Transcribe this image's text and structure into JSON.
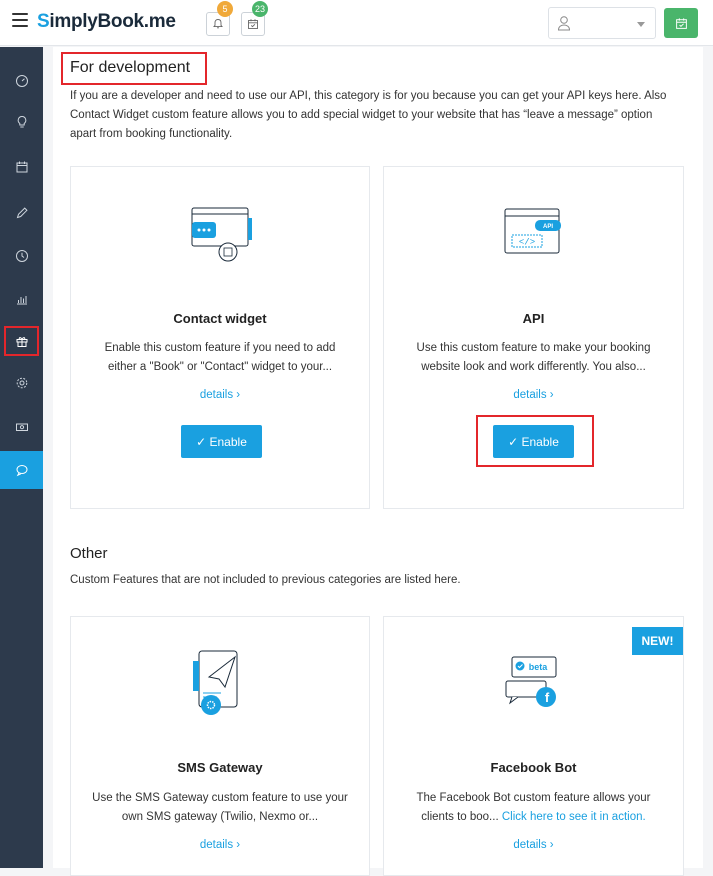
{
  "app": {
    "logo_s": "S",
    "logo_rest": "implyBook.me"
  },
  "header": {
    "notifications_count": "5",
    "calendar_count": "23"
  },
  "sections": {
    "development": {
      "title": "For development",
      "description": "If you are a developer and need to use our API, this category is for you because you can get your API keys here. Also Contact Widget custom feature allows you to add special widget to your website that has “leave a message” option apart from booking functionality."
    },
    "other": {
      "title": "Other",
      "description": "Custom Features that are not included to previous categories are listed here."
    }
  },
  "cards": {
    "contact_widget": {
      "title": "Contact widget",
      "description": "Enable this custom feature if you need to add either a \"Book\" or \"Contact\" widget to your...",
      "details": "details ›",
      "button": "✓ Enable"
    },
    "api": {
      "title": "API",
      "description": "Use this custom feature to make your booking website look and work differently. You also...",
      "details": "details ›",
      "button": "✓ Enable",
      "icon_label": "API",
      "icon_code": "</>"
    },
    "sms_gateway": {
      "title": "SMS Gateway",
      "description": "Use the SMS Gateway custom feature to use your own SMS gateway (Twilio, Nexmo or...",
      "details": "details ›"
    },
    "facebook_bot": {
      "title": "Facebook Bot",
      "description_start": "The Facebook Bot custom feature allows your clients to boo...",
      "description_link": "Click here to see it in action.",
      "details": "details ›",
      "badge": "NEW!",
      "icon_label": "beta"
    }
  },
  "colors": {
    "accent": "#1aa0e0",
    "sidebar": "#2d3a4c",
    "highlight": "#e3262b",
    "green": "#4ab56b"
  }
}
